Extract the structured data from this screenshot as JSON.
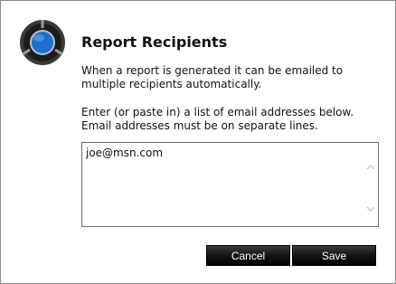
{
  "dialog": {
    "title": "Report Recipients",
    "intro_line_1": "When a report is generated it can be emailed to",
    "intro_line_2": "multiple recipients automatically.",
    "instructions_line_1": "Enter (or paste in) a list of email addresses below.",
    "instructions_line_2": "Email addresses must be on separate lines.",
    "recipients_value": "joe@msn.com",
    "cancel_label": "Cancel",
    "save_label": "Save"
  },
  "icons": {
    "logo": "app-logo-icon",
    "scroll_up": "chevron-up-icon",
    "scroll_down": "chevron-down-icon"
  },
  "colors": {
    "button_bg": "#1a1a1a",
    "logo_blue": "#1f6fd0",
    "logo_ring": "#2b2b2b"
  }
}
